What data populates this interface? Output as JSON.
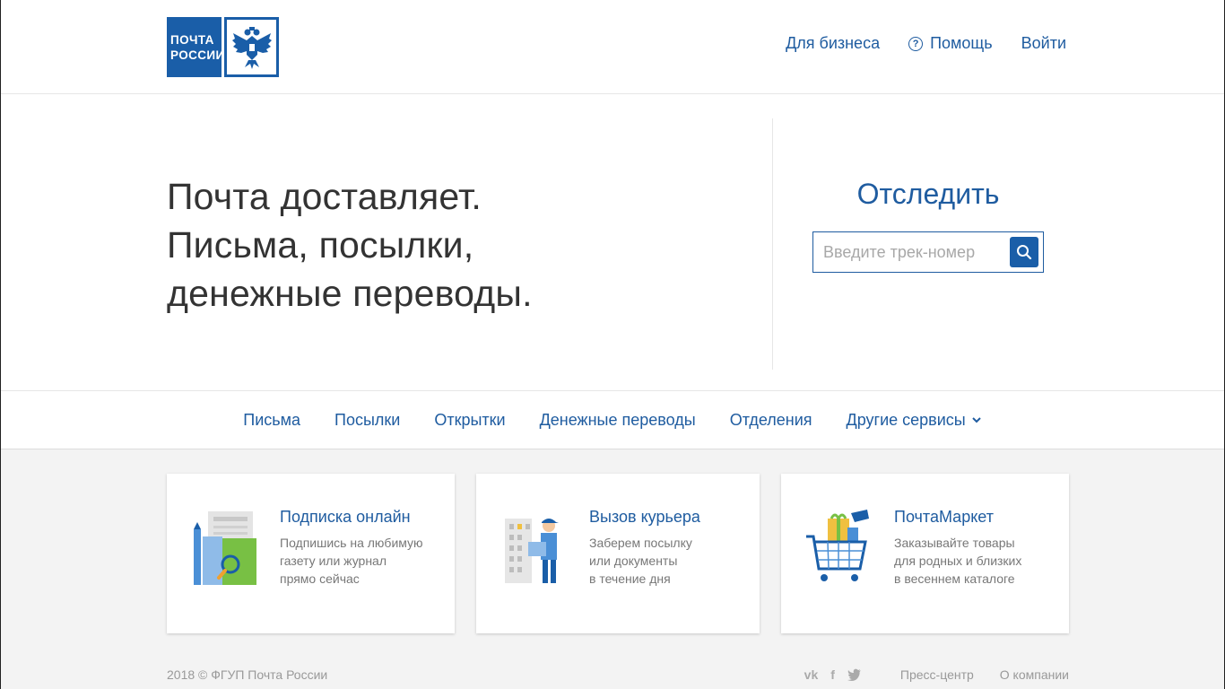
{
  "header": {
    "logo_line1": "ПОЧТА",
    "logo_line2": "РОССИИ",
    "nav": {
      "business": "Для бизнеса",
      "help": "Помощь",
      "login": "Войти"
    }
  },
  "hero": {
    "line1": "Почта доставляет.",
    "line2": "Письма, посылки,",
    "line3": "денежные переводы."
  },
  "tracking": {
    "title": "Отследить",
    "placeholder": "Введите трек-номер"
  },
  "mainnav": {
    "items": [
      "Письма",
      "Посылки",
      "Открытки",
      "Денежные переводы",
      "Отделения",
      "Другие сервисы"
    ]
  },
  "cards": [
    {
      "title": "Подписка онлайн",
      "desc": [
        "Подпишись на любимую",
        "газету или журнал",
        "прямо сейчас"
      ],
      "icon": "newspaper-magnifier-icon"
    },
    {
      "title": "Вызов курьера",
      "desc": [
        "Заберем посылку",
        "или документы",
        "в течение дня"
      ],
      "icon": "courier-icon"
    },
    {
      "title": "ПочтаМаркет",
      "desc": [
        "Заказывайте товары",
        "для родных и близких",
        "в весеннем каталоге"
      ],
      "icon": "shopping-cart-icon"
    }
  ],
  "footer": {
    "copyright": "2018 © ФГУП Почта России",
    "press": "Пресс-центр",
    "about": "О компании"
  },
  "colors": {
    "brand_blue": "#1a5ea8",
    "link_blue": "#1f5ca0"
  }
}
